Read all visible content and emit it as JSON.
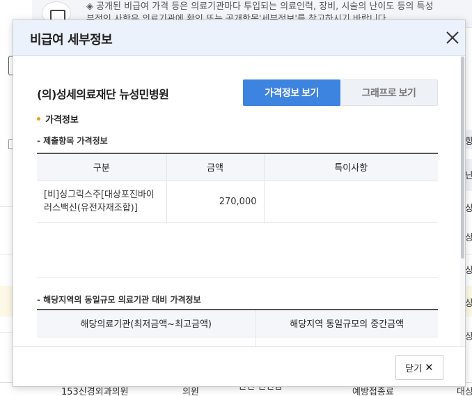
{
  "background": {
    "notice_line1": "◈ 공개된 비급여 가격 등은 의료기관마다 투입되는 의료인력, 장비, 시술의 난이도 등의 특성",
    "notice_line2": "부적인 사항은 의료기관에 확인 또는 공개항목'세부정보'를 참고하시기 바랍니다.",
    "right_chars": [
      "항",
      "난",
      "상",
      "상",
      "상",
      "상",
      "상"
    ],
    "bottom_row": [
      "153신경외과의원",
      "의원",
      "인천 인천남",
      "예방접종료",
      "대상"
    ]
  },
  "modal": {
    "title": "비급여 세부정보",
    "hospital_name": "(의)성세의료재단 뉴성민병원",
    "tabs": {
      "price": "가격정보 보기",
      "graph": "그래프로 보기"
    },
    "section_title": "가격정보",
    "table1": {
      "caption": "- 제출항목 가격정보",
      "headers": [
        "구분",
        "금액",
        "특이사항"
      ],
      "rows": [
        {
          "name": "[비]싱그릭스주[대상포진바이러스백신(유전자재조합)]",
          "amount": "270,000",
          "note": ""
        }
      ]
    },
    "table2": {
      "caption": "- 해당지역의 동일규모 의료기관 대비 가격정보",
      "headers": [
        "해당의료기관(최저금액~최고금액)",
        "해당지역 동일규모의 중간금액"
      ]
    },
    "footer": {
      "close_label": "닫기"
    }
  }
}
